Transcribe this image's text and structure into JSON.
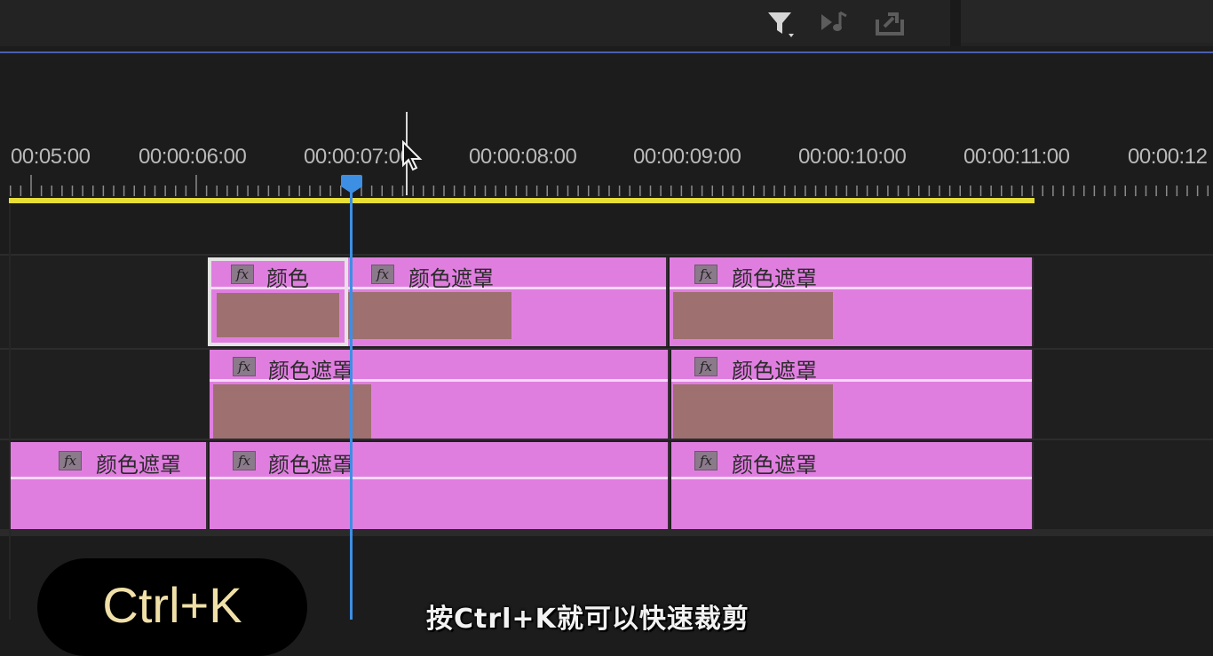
{
  "ruler": {
    "labels": [
      "00:05:00",
      "00:00:06:00",
      "00:00:07:00",
      "00:00:08:00",
      "00:00:09:00",
      "00:00:10:00",
      "00:00:11:00",
      "00:00:12"
    ]
  },
  "toolbar": {
    "icons": [
      "filter-icon",
      "audio-icon",
      "export-icon"
    ]
  },
  "tracks": {
    "v3": {
      "clip1": {
        "label": "颜色",
        "fx": "fx"
      },
      "clip2": {
        "label": "颜色遮罩",
        "fx": "fx"
      },
      "clip3": {
        "label": "颜色遮罩",
        "fx": "fx"
      }
    },
    "v2": {
      "clip1": {
        "label": "颜色遮罩",
        "fx": "fx"
      },
      "clip2": {
        "label": "颜色遮罩",
        "fx": "fx"
      }
    },
    "v1": {
      "clip1": {
        "label": "颜色遮罩",
        "fx": "fx"
      },
      "clip2": {
        "label": "颜色遮罩",
        "fx": "fx"
      },
      "clip3": {
        "label": "颜色遮罩",
        "fx": "fx"
      }
    }
  },
  "colors": {
    "clip": "#e07ee0",
    "thumb": "#9e7070",
    "playhead": "#3d8fe4",
    "workarea": "#e7de36"
  },
  "overlay": {
    "shortcut": "Ctrl+K",
    "subtitle": "按Ctrl+K就可以快速裁剪"
  }
}
